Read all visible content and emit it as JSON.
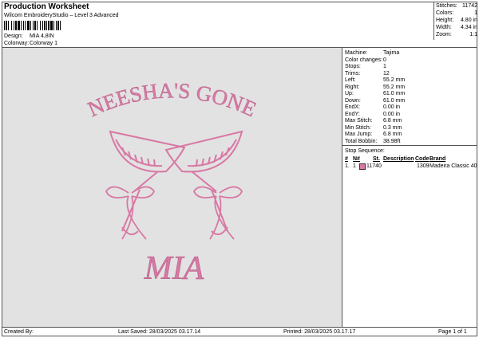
{
  "header": {
    "title": "Production Worksheet",
    "subtitle": "Wilcom EmbroideryStudio – Level 3 Advanced",
    "design_label": "Design:",
    "design_value": "MIA 4,8IN",
    "colorway_label": "Colorway:",
    "colorway_value": "Colorway 1"
  },
  "stats": [
    {
      "label": "Stitches:",
      "value": "11742"
    },
    {
      "label": "Colors:",
      "value": "1"
    },
    {
      "label": "Height:",
      "value": "4.80 in"
    },
    {
      "label": "Width:",
      "value": "4.34 in"
    },
    {
      "label": "Zoom:",
      "value": "1:1"
    }
  ],
  "machine_info": [
    {
      "label": "Machine:",
      "value": "Tajima"
    },
    {
      "label": "Color changes:",
      "value": "0"
    },
    {
      "label": "Stops:",
      "value": "1"
    },
    {
      "label": "Trims:",
      "value": "12"
    },
    {
      "label": "Left:",
      "value": "55.2 mm"
    },
    {
      "label": "Right:",
      "value": "55.2 mm"
    },
    {
      "label": "Up:",
      "value": "61.0 mm"
    },
    {
      "label": "Down:",
      "value": "61.0 mm"
    },
    {
      "label": "EndX:",
      "value": "0.00 in"
    },
    {
      "label": "EndY:",
      "value": "0.00 in"
    },
    {
      "label": "Max Stitch:",
      "value": "6.8 mm"
    },
    {
      "label": "Min Stitch:",
      "value": "0.3 mm"
    },
    {
      "label": "Max Jump:",
      "value": "6.8 mm"
    },
    {
      "label": "Total Bobbin:",
      "value": "38.98ft"
    }
  ],
  "stop_sequence": {
    "title": "Stop Sequence:",
    "columns": [
      "#",
      "N#",
      "St.",
      "Description",
      "Code",
      "Brand"
    ],
    "rows": [
      {
        "num": "1.",
        "n": "1",
        "stitches": "11740",
        "description": "",
        "code": "1309",
        "brand": "Madeira Classic 40",
        "color": "#d878a4"
      }
    ]
  },
  "design": {
    "arc_text": "NEESHA'S GONE",
    "name_text": "MIA",
    "thread_color": "#d878a4"
  },
  "footer": {
    "created_by": "Created By:",
    "last_saved": "Last Saved: 28/03/2025 03.17.14",
    "printed": "Printed: 28/03/2025 03.17.17",
    "page": "Page 1 of 1"
  }
}
